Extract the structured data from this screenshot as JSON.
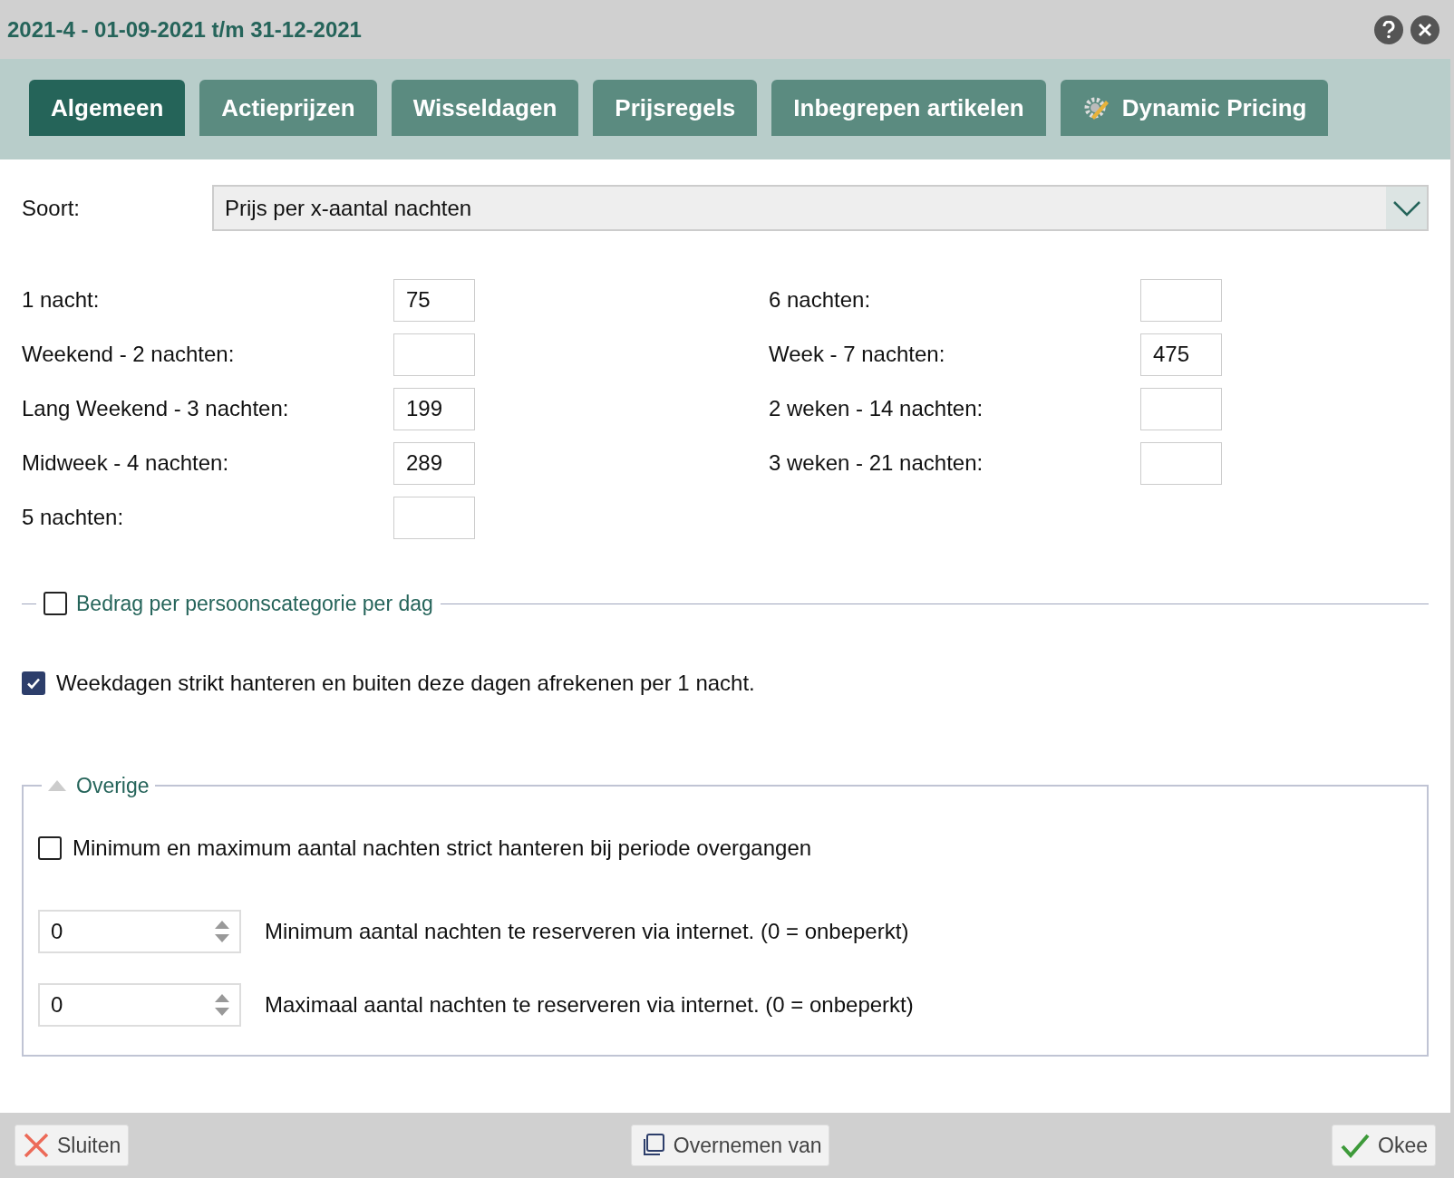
{
  "window": {
    "title": "2021-4 - 01-09-2021 t/m 31-12-2021"
  },
  "tabs": [
    {
      "label": "Algemeen",
      "selected": true
    },
    {
      "label": "Actieprijzen",
      "selected": false
    },
    {
      "label": "Wisseldagen",
      "selected": false
    },
    {
      "label": "Prijsregels",
      "selected": false
    },
    {
      "label": "Inbegrepen artikelen",
      "selected": false
    },
    {
      "label": "Dynamic Pricing",
      "selected": false,
      "kind": "icon"
    }
  ],
  "soort": {
    "label": "Soort:",
    "value": "Prijs per x-aantal nachten"
  },
  "prices_left": [
    {
      "label": "1 nacht:",
      "value": "75"
    },
    {
      "label": "Weekend - 2 nachten:"
    },
    {
      "label": "Lang Weekend - 3 nachten:",
      "value": "199"
    },
    {
      "label": "Midweek - 4 nachten:",
      "value": "289"
    },
    {
      "label": "5 nachten:"
    }
  ],
  "prices_right": [
    {
      "label": "6 nachten:"
    },
    {
      "label": "Week - 7 nachten:",
      "value": "475"
    },
    {
      "label": "2 weken - 14 nachten:"
    },
    {
      "label": "3 weken - 21 nachten:"
    }
  ],
  "person_category": {
    "label": "Bedrag per persoonscategorie per dag",
    "checked": false
  },
  "weekdays": {
    "label": "Weekdagen strikt hanteren en buiten deze dagen afrekenen per 1 nacht.",
    "checked": true
  },
  "overige": {
    "title": "Overige",
    "expanded": true,
    "strict": {
      "label": "Minimum en maximum aantal nachten strict hanteren bij periode overgangen",
      "checked": false
    },
    "spinners": [
      {
        "value": "0",
        "label": "Minimum aantal nachten te reserveren via internet. (0 = onbeperkt)"
      },
      {
        "value": "0",
        "label": "Maximaal aantal nachten te reserveren via internet. (0 = onbeperkt)"
      }
    ]
  },
  "footer": [
    {
      "label": "Sluiten",
      "kind": "close"
    },
    {
      "label": "Overnemen van",
      "kind": "copy"
    },
    {
      "label": "Okee",
      "kind": "ok"
    }
  ]
}
